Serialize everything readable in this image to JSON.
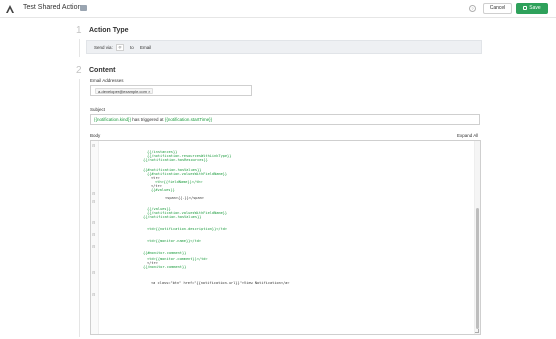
{
  "header": {
    "title": "Test Shared Action",
    "help_icon": "question-circle-icon",
    "cancel_label": "Cancel",
    "save_label": "Save",
    "save_color": "#2ea15b"
  },
  "action_type": {
    "number": "1",
    "title": "Action Type",
    "send_via_label": "Send via:",
    "send_via_icon_text": "@",
    "to_label": "to",
    "channel": "Email"
  },
  "content": {
    "number": "2",
    "title": "Content",
    "email_label": "Email Addresses",
    "email_chip": "a-developer@example.com ×",
    "subject_label": "Subject",
    "subject_tok1": "{{notification.kind}}",
    "subject_mid": " has triggered at ",
    "subject_tok2": "{{notification.startTime}}",
    "body_label": "Body",
    "expand_all": "Expand All"
  },
  "body_lines": [
    {
      "fold": "⊟",
      "text": ""
    },
    {
      "text": "{{/instances}}",
      "cls": "c-green"
    },
    {
      "text": "{{/notification.resourcesWithLinkType}}",
      "cls": "c-green"
    },
    {
      "text": "{{/notification.hasResources}}",
      "cls": "c-green"
    },
    {
      "text": "{{#notification.hasValues}}",
      "cls": "c-green"
    },
    {
      "text": "{{#notification.valuesWithFieldName}}",
      "cls": "c-green"
    },
    {
      "text": "<tr>",
      "cls": "c-dark"
    },
    {
      "text": "<th>{{fieldName}}</th>",
      "cls": "c-green"
    },
    {
      "text": "</tr>",
      "cls": "c-dark"
    },
    {
      "text": "{{#values}}",
      "cls": "c-green"
    },
    {
      "fold": "⊟",
      "text": ""
    },
    {
      "text": "<span>{{.}}</span>",
      "cls": "c-dark"
    },
    {
      "fold": "⊟",
      "text": ""
    },
    {
      "text": "{{/values}}",
      "cls": "c-green"
    },
    {
      "text": "{{/notification.valuesWithFieldName}}",
      "cls": "c-green"
    },
    {
      "text": "{{/notification.hasValues}}",
      "cls": "c-green"
    },
    {
      "fold": "⊟",
      "text": ""
    },
    {
      "text": "<td>{{notification.description}}</td>",
      "cls": "c-green"
    },
    {
      "fold": "⊟",
      "text": ""
    },
    {
      "text": "<td>{{monitor.name}}</td>",
      "cls": "c-green"
    },
    {
      "fold": "⊟",
      "text": ""
    },
    {
      "text": "{{#monitor.comment}}",
      "cls": "c-green"
    },
    {
      "text": "<td>{{monitor.comment}}</td>",
      "cls": "c-green"
    },
    {
      "text": "</tr>",
      "cls": "c-dark"
    },
    {
      "text": "{{/monitor.comment}}",
      "cls": "c-green"
    },
    {
      "fold": "⊟",
      "text": ""
    },
    {
      "text": "<a class=\"btn\" href=\"{{notification.url}}\">View Notification</a>",
      "cls": "c-dark"
    },
    {
      "fold": "⊟",
      "text": ""
    }
  ]
}
